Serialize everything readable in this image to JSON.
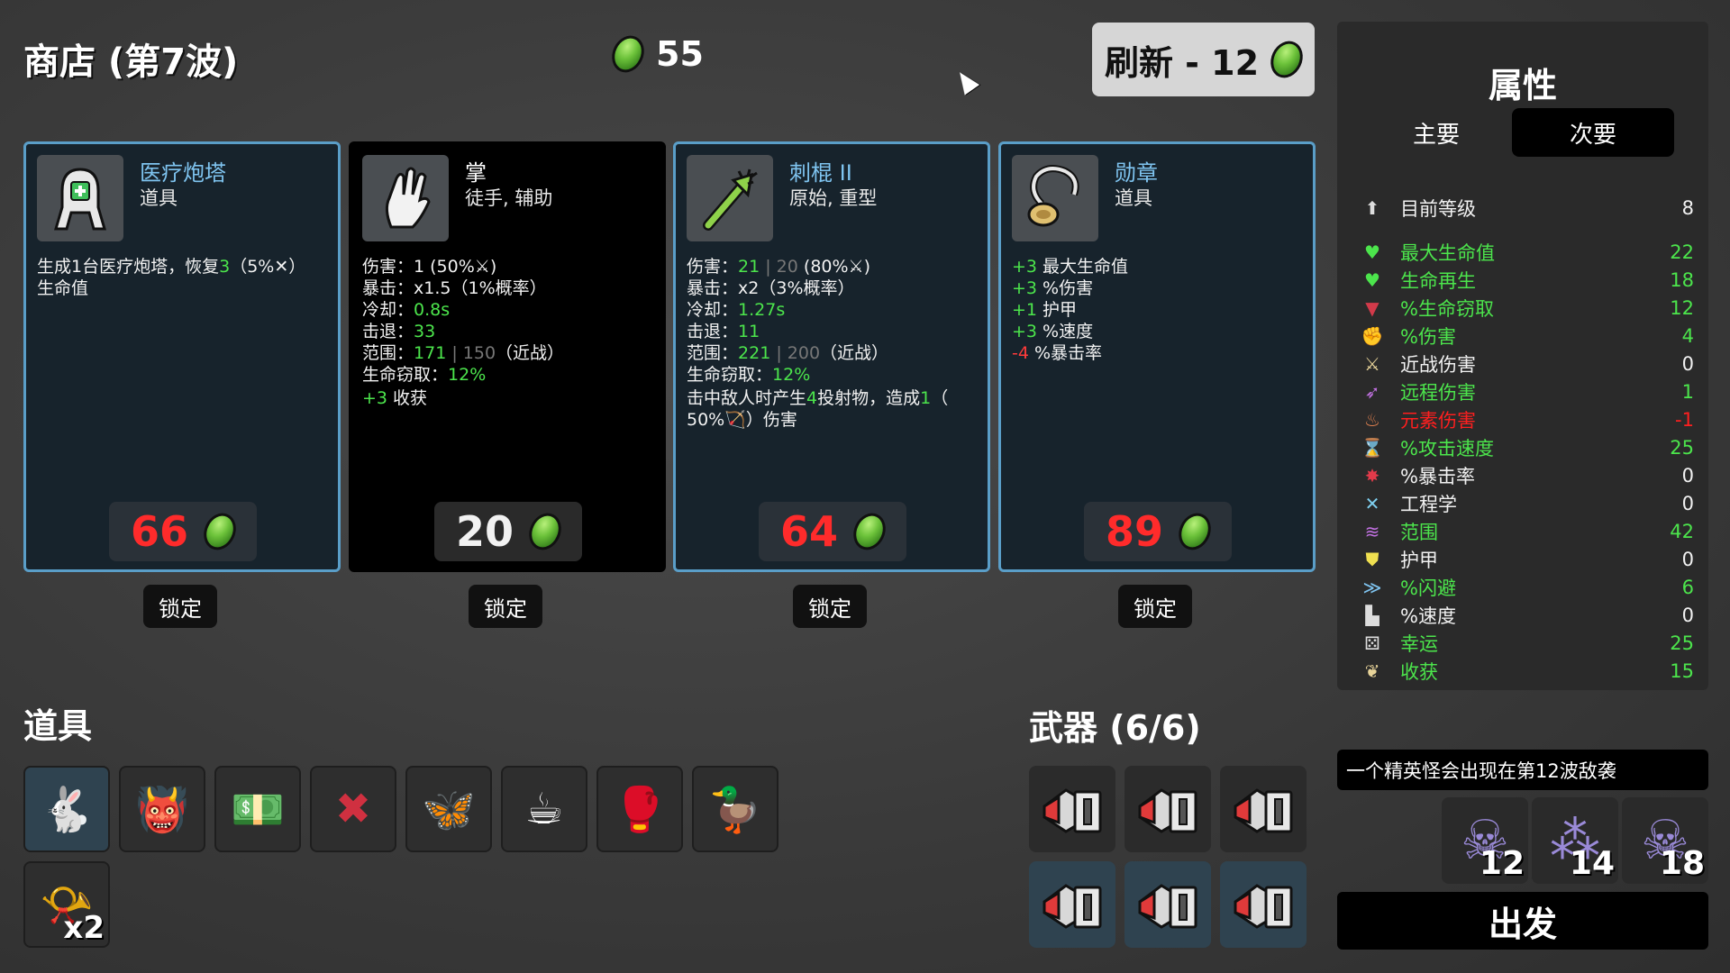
{
  "header": {
    "title": "商店 (第7波)",
    "money": "55",
    "reroll_label": "刷新 - 12"
  },
  "cards": [
    {
      "name": "医疗炮塔",
      "type": "道具",
      "icon": "medical-turret-icon",
      "desc_lines": [
        [
          "生成1台医疗炮塔，恢复",
          "3",
          "（5%✕）"
        ],
        [
          "生命值"
        ]
      ],
      "price": "66",
      "price_color": "#ff2b2b",
      "lock": "锁定"
    },
    {
      "name": "掌",
      "type": "徒手, 辅助",
      "icon": "palm-hand-icon",
      "stats": [
        {
          "k": "伤害：",
          "v": "1",
          "extra": " (50%⚔)"
        },
        {
          "k": "暴击：",
          "v": "x1.5",
          "extra": "（1%概率）"
        },
        {
          "k": "冷却：",
          "v": "0.8s",
          "extra": ""
        },
        {
          "k": "击退：",
          "v": "33",
          "extra": ""
        },
        {
          "k": "范围：",
          "v": "171",
          "gray": " | 150",
          "extra": "（近战）"
        },
        {
          "k": "生命窃取：",
          "v": "12%",
          "extra": ""
        }
      ],
      "bonus": "+3 收获",
      "price": "20",
      "price_color": "#f2f2f2",
      "lock": "锁定"
    },
    {
      "name": "刺棍 II",
      "type": "原始, 重型",
      "icon": "spiked-club-icon",
      "stats": [
        {
          "k": "伤害：",
          "v": "21",
          "gray": " | 20",
          "extra": " (80%⚔)"
        },
        {
          "k": "暴击：",
          "v": "x2",
          "extra": "（3%概率）"
        },
        {
          "k": "冷却：",
          "v": "1.27s",
          "extra": ""
        },
        {
          "k": "击退：",
          "v": "11",
          "extra": ""
        },
        {
          "k": "范围：",
          "v": "221",
          "gray": " | 200",
          "extra": "（近战）"
        },
        {
          "k": "生命窃取：",
          "v": "12%",
          "extra": ""
        }
      ],
      "effect_a": "击中敌人时产生",
      "effect_b": "4",
      "effect_c": "投射物，造成",
      "effect_d": "1",
      "effect_e": "（",
      "effect_f": "50%🏹）伤害",
      "price": "64",
      "price_color": "#ff2b2b",
      "lock": "锁定"
    },
    {
      "name": "勋章",
      "type": "道具",
      "icon": "medal-icon",
      "mods": [
        {
          "v": "+3",
          "t": " 最大生命值",
          "c": "#4ce54c"
        },
        {
          "v": "+3",
          "t": " %伤害",
          "c": "#4ce54c"
        },
        {
          "v": "+1",
          "t": " 护甲",
          "c": "#4ce54c"
        },
        {
          "v": "+3",
          "t": " %速度",
          "c": "#4ce54c"
        },
        {
          "v": "-4",
          "t": " %暴击率",
          "c": "#ff3b3b"
        }
      ],
      "price": "89",
      "price_color": "#ff2b2b",
      "lock": "锁定"
    }
  ],
  "items_section": {
    "title": "道具",
    "items": [
      {
        "icon": "rabbit-icon",
        "glyph": "🐇"
      },
      {
        "icon": "demon-mask-icon",
        "glyph": "👹"
      },
      {
        "icon": "cash-icon",
        "glyph": "💵"
      },
      {
        "icon": "thorns-icon",
        "glyph": "✖"
      },
      {
        "icon": "butterfly-icon",
        "glyph": "🦋"
      },
      {
        "icon": "coffee-cup-icon",
        "glyph": "☕"
      },
      {
        "icon": "boxing-glove-icon",
        "glyph": "🥊"
      },
      {
        "icon": "rubber-duck-icon",
        "glyph": "🦆"
      },
      {
        "icon": "horn-icon",
        "glyph": "📯",
        "count": "x2"
      }
    ]
  },
  "weapons_section": {
    "title": "武器 (6/6)",
    "count": 6
  },
  "stats": {
    "title": "属性",
    "tab_primary": "主要",
    "tab_secondary": "次要",
    "rows": [
      {
        "icon": "level-icon",
        "glyph": "⬆",
        "label": "目前等级",
        "value": "8",
        "color": "#f2f2f2",
        "icolor": "#ddd"
      },
      {
        "icon": "heart-icon",
        "glyph": "♥",
        "label": "最大生命值",
        "value": "22",
        "color": "#4ce54c",
        "icolor": "#4ce54c"
      },
      {
        "icon": "regen-heart-icon",
        "glyph": "♥",
        "label": "生命再生",
        "value": "18",
        "color": "#4ce54c",
        "icolor": "#4ce54c"
      },
      {
        "icon": "lifesteal-icon",
        "glyph": "▼",
        "label": "%生命窃取",
        "value": "12",
        "color": "#4ce54c",
        "icolor": "#d23a4a"
      },
      {
        "icon": "muscle-icon",
        "glyph": "✊",
        "label": "%伤害",
        "value": "4",
        "color": "#4ce54c",
        "icolor": "#e25a5a"
      },
      {
        "icon": "sword-icon",
        "glyph": "⚔",
        "label": "近战伤害",
        "value": "0",
        "color": "#f2f2f2",
        "icolor": "#e8d49a"
      },
      {
        "icon": "bow-icon",
        "glyph": "➶",
        "label": "远程伤害",
        "value": "1",
        "color": "#4ce54c",
        "icolor": "#c070e0"
      },
      {
        "icon": "flame-icon",
        "glyph": "♨",
        "label": "元素伤害",
        "value": "-1",
        "color": "#ff1f1f",
        "icolor": "#e08050"
      },
      {
        "icon": "hourglass-icon",
        "glyph": "⌛",
        "label": "%攻击速度",
        "value": "25",
        "color": "#4ce54c",
        "icolor": "#ddd"
      },
      {
        "icon": "crit-icon",
        "glyph": "✸",
        "label": "%暴击率",
        "value": "0",
        "color": "#f2f2f2",
        "icolor": "#e23a4a"
      },
      {
        "icon": "wrench-icon",
        "glyph": "✕",
        "label": "工程学",
        "value": "0",
        "color": "#f2f2f2",
        "icolor": "#7fd0f0"
      },
      {
        "icon": "range-icon",
        "glyph": "≋",
        "label": "范围",
        "value": "42",
        "color": "#4ce54c",
        "icolor": "#c070e0"
      },
      {
        "icon": "shield-icon",
        "glyph": "⛊",
        "label": "护甲",
        "value": "0",
        "color": "#f2f2f2",
        "icolor": "#f0e050"
      },
      {
        "icon": "dodge-icon",
        "glyph": "≫",
        "label": "%闪避",
        "value": "6",
        "color": "#4ce54c",
        "icolor": "#7fc4f0"
      },
      {
        "icon": "boot-icon",
        "glyph": "▙",
        "label": "%速度",
        "value": "0",
        "color": "#f2f2f2",
        "icolor": "#ddd"
      },
      {
        "icon": "dice-icon",
        "glyph": "⚄",
        "label": "幸运",
        "value": "25",
        "color": "#4ce54c",
        "icolor": "#ddd"
      },
      {
        "icon": "harvest-icon",
        "glyph": "❦",
        "label": "收获",
        "value": "15",
        "color": "#4ce54c",
        "icolor": "#e8d49a"
      }
    ]
  },
  "elite_notice": "一个精英怪会出现在第12波敌袭",
  "waves": [
    {
      "icon": "horned-skull-icon",
      "glyph": "☠",
      "num": "12"
    },
    {
      "icon": "bug-swarm-icon",
      "glyph": "⁂",
      "num": "14"
    },
    {
      "icon": "horned-skull-icon",
      "glyph": "☠",
      "num": "18"
    }
  ],
  "go_label": "出发"
}
